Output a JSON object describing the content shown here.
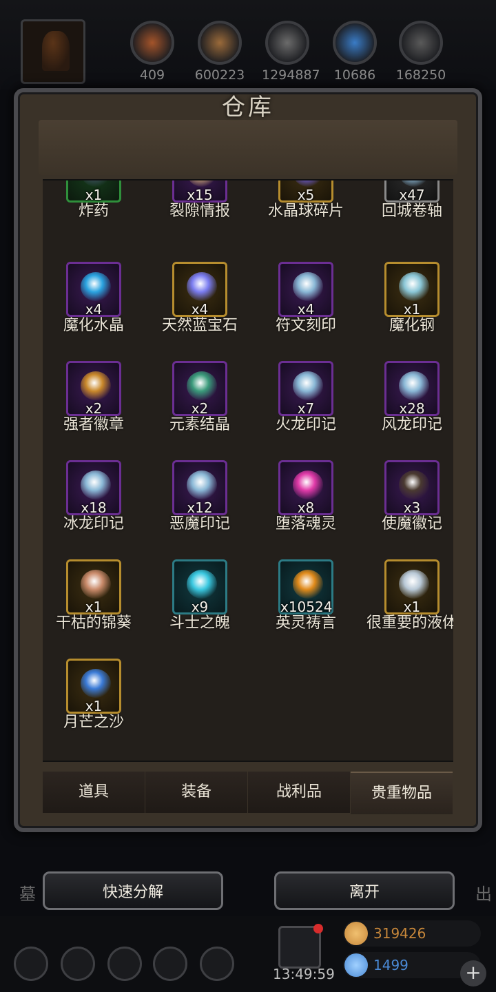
{
  "resources": [
    {
      "value": "409",
      "icon": "meat-icon",
      "color": "#a4542a"
    },
    {
      "value": "600223",
      "icon": "wood-icon",
      "color": "#9a6a3a"
    },
    {
      "value": "1294887",
      "icon": "stone-icon",
      "color": "#6b6b6b"
    },
    {
      "value": "10686",
      "icon": "crystal-icon",
      "color": "#3a7cc7"
    },
    {
      "value": "168250",
      "icon": "iron-icon",
      "color": "#5a5a5a"
    }
  ],
  "title": "仓库",
  "items": [
    {
      "name": "炸药",
      "qty": "x1",
      "rarity": "green",
      "icon": "bomb-icon",
      "color": "#3a4a5a"
    },
    {
      "name": "裂隙情报",
      "qty": "x15",
      "rarity": "purple",
      "icon": "scroll-icon",
      "color": "#c9a673"
    },
    {
      "name": "水晶球碎片",
      "qty": "x5",
      "rarity": "gold",
      "icon": "crystal-shard-icon",
      "color": "#6a5ad8"
    },
    {
      "name": "回城卷轴",
      "qty": "x47",
      "rarity": "grey",
      "icon": "swirl-icon",
      "color": "#8ab8d6"
    },
    {
      "name": "魔化水晶",
      "qty": "x4",
      "rarity": "purple",
      "icon": "blue-crystal-icon",
      "color": "#2aa3e0"
    },
    {
      "name": "天然蓝宝石",
      "qty": "x4",
      "rarity": "gold",
      "icon": "sapphire-icon",
      "color": "#7a7cf0"
    },
    {
      "name": "符文刻印",
      "qty": "x4",
      "rarity": "purple",
      "icon": "swirl-icon",
      "color": "#8ab8d6"
    },
    {
      "name": "魔化钢",
      "qty": "x1",
      "rarity": "gold",
      "icon": "steel-ingot-icon",
      "color": "#8ac6d6"
    },
    {
      "name": "强者徽章",
      "qty": "x2",
      "rarity": "purple",
      "icon": "badge-icon",
      "color": "#c9882a"
    },
    {
      "name": "元素结晶",
      "qty": "x2",
      "rarity": "purple",
      "icon": "pyramid-icon",
      "color": "#3a9a7a"
    },
    {
      "name": "火龙印记",
      "qty": "x7",
      "rarity": "purple",
      "icon": "swirl-icon",
      "color": "#8ab8d6"
    },
    {
      "name": "风龙印记",
      "qty": "x28",
      "rarity": "purple",
      "icon": "swirl-icon",
      "color": "#8ab8d6"
    },
    {
      "name": "冰龙印记",
      "qty": "x18",
      "rarity": "purple",
      "icon": "swirl-icon",
      "color": "#8ab8d6"
    },
    {
      "name": "恶魔印记",
      "qty": "x12",
      "rarity": "purple",
      "icon": "swirl-icon",
      "color": "#8ab8d6"
    },
    {
      "name": "堕落魂灵",
      "qty": "x8",
      "rarity": "purple",
      "icon": "soul-orb-icon",
      "color": "#e03aa8"
    },
    {
      "name": "使魔徽记",
      "qty": "x3",
      "rarity": "purple",
      "icon": "dark-mark-icon",
      "color": "#4a3a30"
    },
    {
      "name": "干枯的锦葵",
      "qty": "x1",
      "rarity": "gold",
      "icon": "flower-icon",
      "color": "#c98a6a"
    },
    {
      "name": "斗士之魄",
      "qty": "x9",
      "rarity": "teal",
      "icon": "spirit-flame-icon",
      "color": "#3ac8e0"
    },
    {
      "name": "英灵祷言",
      "qty": "x10524",
      "rarity": "teal",
      "icon": "golden-orb-icon",
      "color": "#e08a1a"
    },
    {
      "name": "很重要的液体",
      "qty": "x1",
      "rarity": "gold",
      "icon": "liquid-icon",
      "color": "#b8c8d6"
    },
    {
      "name": "月芒之沙",
      "qty": "x1",
      "rarity": "gold",
      "icon": "sand-pile-icon",
      "color": "#3a7ad6"
    }
  ],
  "tabs": [
    {
      "label": "道具"
    },
    {
      "label": "装备"
    },
    {
      "label": "战利品"
    },
    {
      "label": "贵重物品",
      "active": true
    }
  ],
  "buttons": {
    "decompose": "快速分解",
    "leave": "离开"
  },
  "side_text": {
    "left": "墓",
    "right": "出"
  },
  "footer": {
    "timer": "13:49:59",
    "gold": "319426",
    "gems": "1499",
    "gold_color": "#c7873a",
    "gem_color": "#4a8ad6"
  }
}
